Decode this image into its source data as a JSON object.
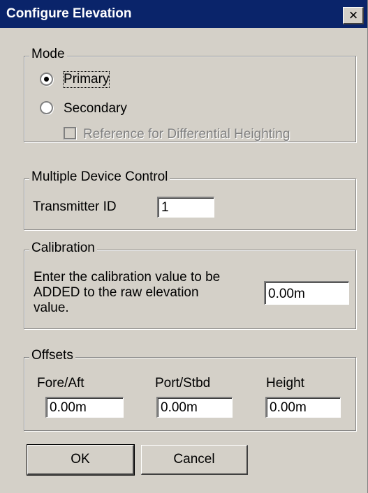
{
  "dialog": {
    "title": "Configure Elevation",
    "close_glyph": "×"
  },
  "mode": {
    "legend": "Mode",
    "primary_label": "Primary",
    "secondary_label": "Secondary",
    "reference_label": "Reference for Differential Heighting",
    "selected": "Primary"
  },
  "multiple_device": {
    "legend": "Multiple Device Control",
    "transmitter_label": "Transmitter ID",
    "transmitter_value": "1"
  },
  "calibration": {
    "legend": "Calibration",
    "line1": "Enter the calibration value to be",
    "line2": "ADDED to the raw elevation",
    "line3": "value.",
    "value": "0.00m"
  },
  "offsets": {
    "legend": "Offsets",
    "fore_aft_label": "Fore/Aft",
    "fore_aft_value": "0.00m",
    "port_stbd_label": "Port/Stbd",
    "port_stbd_value": "0.00m",
    "height_label": "Height",
    "height_value": "0.00m"
  },
  "buttons": {
    "ok_label": "OK",
    "cancel_label": "Cancel"
  }
}
